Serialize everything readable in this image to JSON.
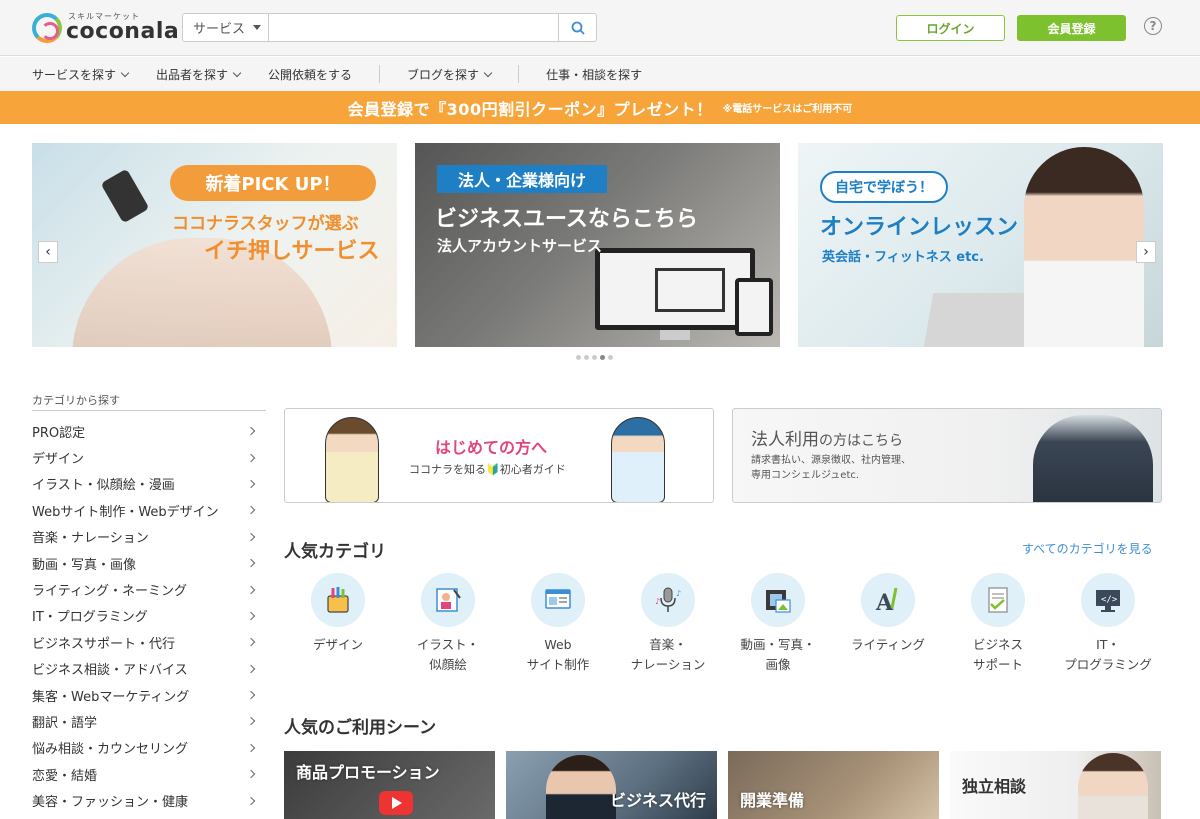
{
  "header": {
    "logo_tagline": "スキルマーケット",
    "logo_text": "coconala",
    "search_category": "サービス",
    "search_placeholder": "",
    "login_label": "ログイン",
    "register_label": "会員登録",
    "help_label": "?"
  },
  "nav": {
    "items": [
      "サービスを探す",
      "出品者を探す",
      "公開依頼をする",
      "ブログを探す",
      "仕事・相談を探す"
    ]
  },
  "promo": {
    "main": "会員登録で『300円割引クーポン』プレゼント！",
    "note": "※電話サービスはご利用不可"
  },
  "carousel": {
    "banner1": {
      "pill": "新着PICK UP！",
      "line1": "ココナラスタッフが選ぶ",
      "line2": "イチ押しサービス"
    },
    "banner2": {
      "tag": "法人・企業様向け",
      "title": "ビジネスユースならこちら",
      "sub": "法人アカウントサービス"
    },
    "banner3": {
      "pill": "自宅で学ぼう！",
      "title": "オンラインレッスン",
      "sub": "英会話・フィットネス etc."
    },
    "prev": "‹",
    "next": "›",
    "dot_count": 5,
    "active_dot": 4
  },
  "sidebar": {
    "title": "カテゴリから探す",
    "items": [
      "PRO認定",
      "デザイン",
      "イラスト・似顔絵・漫画",
      "Webサイト制作・Webデザイン",
      "音楽・ナレーション",
      "動画・写真・画像",
      "ライティング・ネーミング",
      "IT・プログラミング",
      "ビジネスサポート・代行",
      "ビジネス相談・アドバイス",
      "集客・Webマーケティング",
      "翻訳・語学",
      "悩み相談・カウンセリング",
      "恋愛・結婚",
      "美容・ファッション・健康"
    ]
  },
  "guides": {
    "beginner": {
      "title": "はじめての方へ",
      "sub": "ココナラを知る🔰初心者ガイド"
    },
    "corporate": {
      "title_main": "法人利用",
      "title_rest": "の方はこちら",
      "sub1": "請求書払い、源泉徴収、社内管理、",
      "sub2": "専用コンシェルジュetc."
    }
  },
  "popular_categories": {
    "title": "人気カテゴリ",
    "see_all": "すべてのカテゴリを見る",
    "items": [
      {
        "label": "デザイン",
        "icon": "design-icon"
      },
      {
        "label": "イラスト・\n似顔絵",
        "icon": "illustration-icon"
      },
      {
        "label": "Web\nサイト制作",
        "icon": "web-icon"
      },
      {
        "label": "音楽・\nナレーション",
        "icon": "microphone-icon"
      },
      {
        "label": "動画・写真・\n画像",
        "icon": "film-icon"
      },
      {
        "label": "ライティング",
        "icon": "writing-icon"
      },
      {
        "label": "ビジネス\nサポート",
        "icon": "checklist-icon"
      },
      {
        "label": "IT・\nプログラミング",
        "icon": "code-monitor-icon"
      }
    ]
  },
  "popular_scenes": {
    "title": "人気のご利用シーン",
    "items": [
      "商品プロモーション",
      "ビジネス代行",
      "開業準備",
      "独立相談"
    ]
  },
  "colors": {
    "brand_green": "#7dc22e",
    "promo_orange": "#f7a43a",
    "accent_blue": "#1f7fc4",
    "link_blue": "#3f8ed4"
  }
}
